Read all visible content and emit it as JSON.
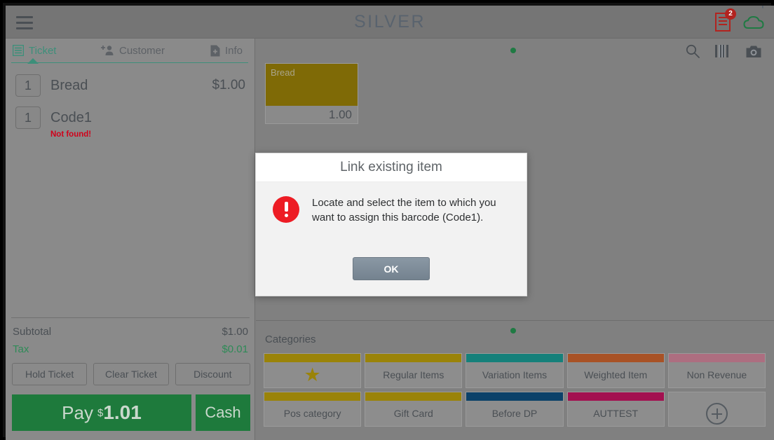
{
  "appbar": {
    "menu_icon": "hamburger-menu-icon",
    "brand": "SILVER",
    "cloud_icon": "cloud-icon",
    "receipt_icon": "receipt-icon",
    "receipt_badge": "2"
  },
  "ticket_panel": {
    "tabs": [
      {
        "label": "Ticket",
        "icon": "list-icon",
        "active": true
      },
      {
        "label": "Customer",
        "icon": "add-person-icon",
        "active": false
      },
      {
        "label": "Info",
        "icon": "file-add-icon",
        "active": false
      }
    ],
    "lines": [
      {
        "qty": "1",
        "name": "Bread",
        "price": "$1.00",
        "note": ""
      },
      {
        "qty": "1",
        "name": "Code1",
        "price": "",
        "note": "Not found!"
      }
    ],
    "totals": [
      {
        "label": "Subtotal",
        "value": "$1.00"
      },
      {
        "label": "Tax",
        "value": "$0.01"
      }
    ],
    "buttons": {
      "hold": "Hold Ticket",
      "clear": "Clear Ticket",
      "discount": "Discount"
    },
    "pay": {
      "label": "Pay",
      "currency": "$",
      "amount": "1.01",
      "cash_label": "Cash"
    }
  },
  "items_pane": {
    "icons": [
      "search-icon",
      "barcode-icon",
      "camera-icon"
    ],
    "tiles": [
      {
        "name": "Bread",
        "price": "1.00",
        "color": "#7f6a06"
      }
    ]
  },
  "categories_pane": {
    "label": "Categories",
    "items": [
      {
        "label": "",
        "icon": "star-icon",
        "color": "#9a8309"
      },
      {
        "label": "Regular Items",
        "icon": "",
        "color": "#9a8309"
      },
      {
        "label": "Variation Items",
        "icon": "",
        "color": "#15807a"
      },
      {
        "label": "Weighted Item",
        "icon": "",
        "color": "#a85226"
      },
      {
        "label": "Non Revenue",
        "icon": "",
        "color": "#ad6e80"
      },
      {
        "label": "Pos category",
        "icon": "",
        "color": "#9a8309"
      },
      {
        "label": "Gift Card",
        "icon": "",
        "color": "#9a8309"
      },
      {
        "label": "Before DP",
        "icon": "",
        "color": "#0b4169"
      },
      {
        "label": "AUTTEST",
        "icon": "",
        "color": "#a31050"
      },
      {
        "label": "",
        "icon": "plus-circle-icon",
        "color": "transparent"
      }
    ]
  },
  "dialog": {
    "title": "Link existing item",
    "icon": "error-exclamation-icon",
    "message": "Locate and select the item to which you want to assign this barcode (Code1).",
    "ok_label": "OK"
  },
  "colors": {
    "accent_green": "#3d8f7a",
    "pay_green": "#1e7a3c",
    "error_red": "#d0021b",
    "dialog_icon_red": "#ed1c24",
    "badge_red": "#b2231f"
  }
}
